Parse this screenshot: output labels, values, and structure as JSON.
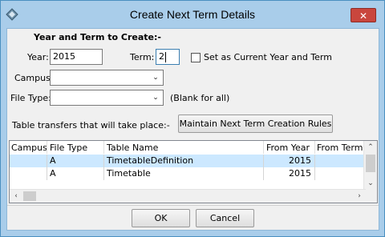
{
  "window": {
    "title": "Create Next Term Details",
    "close_label": "✕"
  },
  "form": {
    "heading": "Year and Term to Create:-",
    "year_label": "Year:",
    "year_value": "2015",
    "term_label": "Term:",
    "term_value": "2",
    "set_current_label": "Set as Current Year and Term",
    "set_current_checked": false,
    "campus_label": "Campus:",
    "campus_value": "",
    "file_type_label": "File Type:",
    "file_type_value": "",
    "file_type_hint": "(Blank for all)",
    "transfers_label": "Table transfers that will take place:-",
    "rules_button": "Maintain Next Term Creation Rules"
  },
  "grid": {
    "columns": [
      "Campus",
      "File Type",
      "Table Name",
      "From Year",
      "From Term"
    ],
    "rows": [
      {
        "campus": "",
        "file_type": "A",
        "table_name": "TimetableDefinition",
        "from_year": "2015",
        "from_term": "",
        "selected": true
      },
      {
        "campus": "",
        "file_type": "A",
        "table_name": "Timetable",
        "from_year": "2015",
        "from_term": "",
        "selected": false
      }
    ]
  },
  "buttons": {
    "ok": "OK",
    "cancel": "Cancel"
  },
  "icons": {
    "app": "diamond-app-icon",
    "dropdown": "chevron-down-icon"
  }
}
